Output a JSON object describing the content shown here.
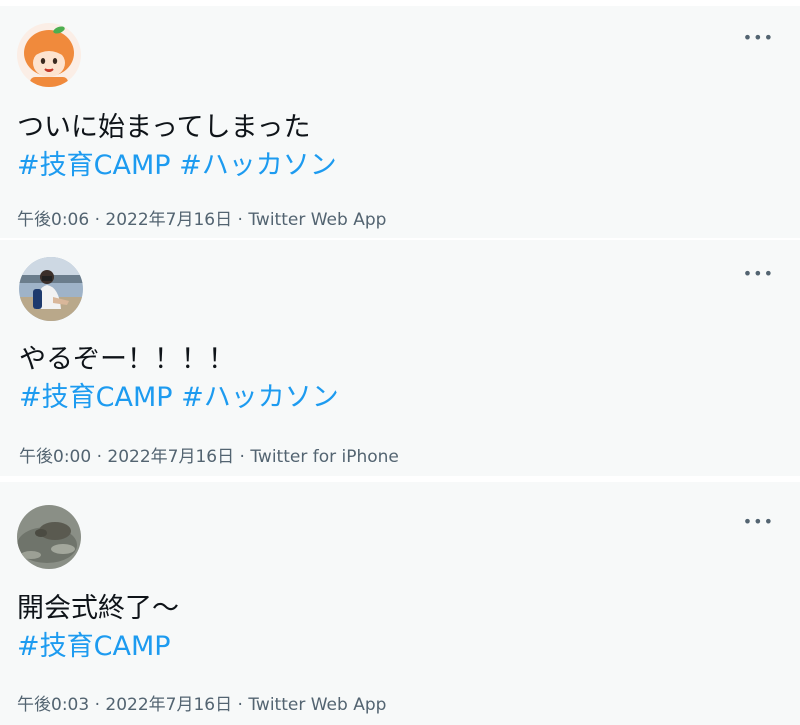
{
  "tweets": [
    {
      "avatar": "orange-mascot-avatar",
      "more_icon": "•••",
      "text": "ついに始まってしまった",
      "hashtags": [
        "#技育CAMP",
        "#ハッカソン"
      ],
      "time": "午後0:06",
      "date": "2022年7月16日",
      "source": "Twitter Web App",
      "separator": "·"
    },
    {
      "avatar": "person-photo-avatar",
      "more_icon": "•••",
      "text": "やるぞー！！！！",
      "hashtags": [
        "#技育CAMP",
        "#ハッカソン"
      ],
      "time": "午後0:00",
      "date": "2022年7月16日",
      "source": "Twitter for iPhone",
      "separator": "·"
    },
    {
      "avatar": "animal-photo-avatar",
      "more_icon": "•••",
      "text": "開会式終了～",
      "hashtags": [
        "#技育CAMP"
      ],
      "time": "午後0:03",
      "date": "2022年7月16日",
      "source": "Twitter Web App",
      "separator": "·"
    }
  ],
  "colors": {
    "hashtag": "#1d9bf0",
    "meta": "#536471",
    "card_bg": "#f7f9f9"
  }
}
